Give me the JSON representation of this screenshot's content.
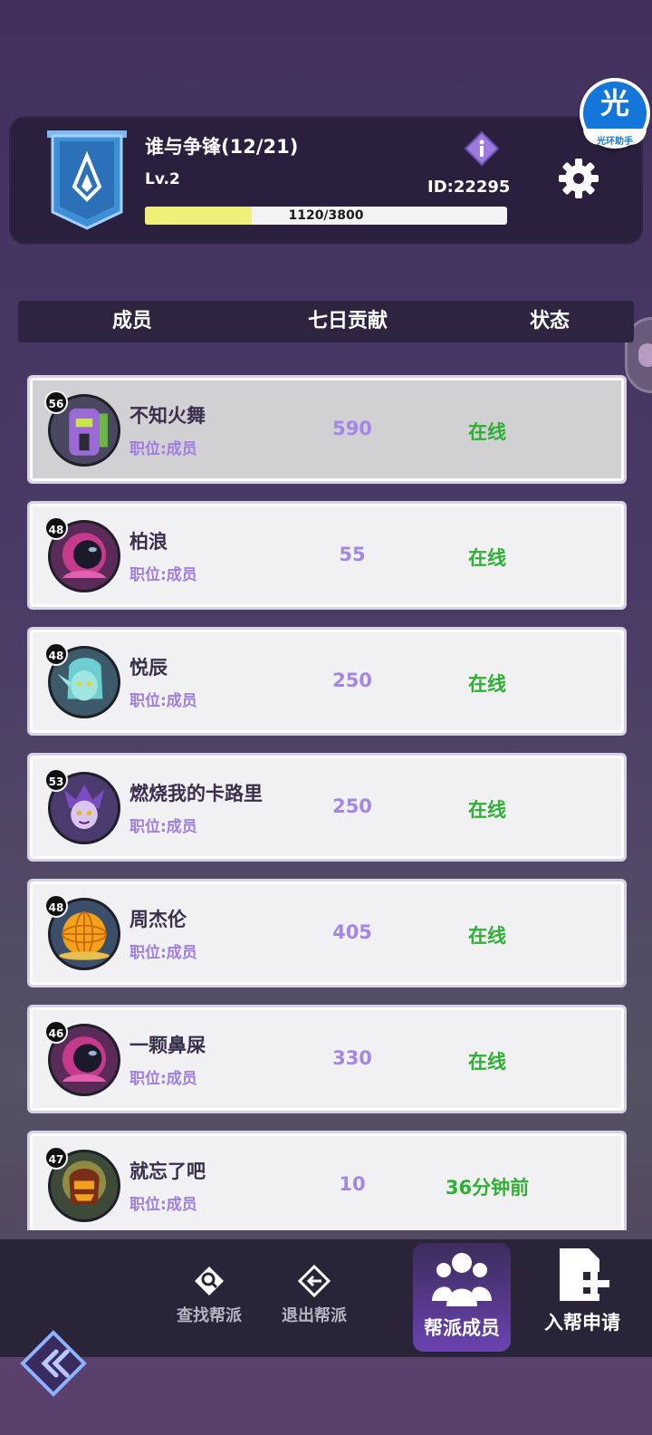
{
  "guild": {
    "name": "谁与争锋(12/21)",
    "level": "Lv.2",
    "id": "ID:22295",
    "xp_text": "1120/3800",
    "xp_current": 1120,
    "xp_max": 3800
  },
  "assistant_badge": {
    "glyph": "光",
    "label": "光环助手"
  },
  "table_header": {
    "member": "成员",
    "contribution": "七日贡献",
    "status": "状态"
  },
  "members": [
    {
      "level": "56",
      "name": "不知火舞",
      "role": "职位:成员",
      "contribution": "590",
      "status": "在线",
      "avatar": "mecha-robot-avatar",
      "selected": true
    },
    {
      "level": "48",
      "name": "柏浪",
      "role": "职位:成员",
      "contribution": "55",
      "status": "在线",
      "avatar": "astronaut-avatar"
    },
    {
      "level": "48",
      "name": "悦辰",
      "role": "职位:成员",
      "contribution": "250",
      "status": "在线",
      "avatar": "cyan-elf-avatar"
    },
    {
      "level": "53",
      "name": "燃烧我的卡路里",
      "role": "职位:成员",
      "contribution": "250",
      "status": "在线",
      "avatar": "purple-jester-avatar"
    },
    {
      "level": "48",
      "name": "周杰伦",
      "role": "职位:成员",
      "contribution": "405",
      "status": "在线",
      "avatar": "golden-orb-avatar"
    },
    {
      "level": "46",
      "name": "一颗鼻屎",
      "role": "职位:成员",
      "contribution": "330",
      "status": "在线",
      "avatar": "astronaut-avatar"
    },
    {
      "level": "47",
      "name": "就忘了吧",
      "role": "职位:成员",
      "contribution": "10",
      "status": "36分钟前",
      "avatar": "lava-golem-avatar"
    }
  ],
  "bottom_nav": {
    "find": "查找帮派",
    "quit": "退出帮派",
    "members": "帮派成员",
    "apply": "入帮申请"
  },
  "colors": {
    "online": "#2eb034",
    "contribution": "#a387e6",
    "role": "#a07ee0"
  }
}
